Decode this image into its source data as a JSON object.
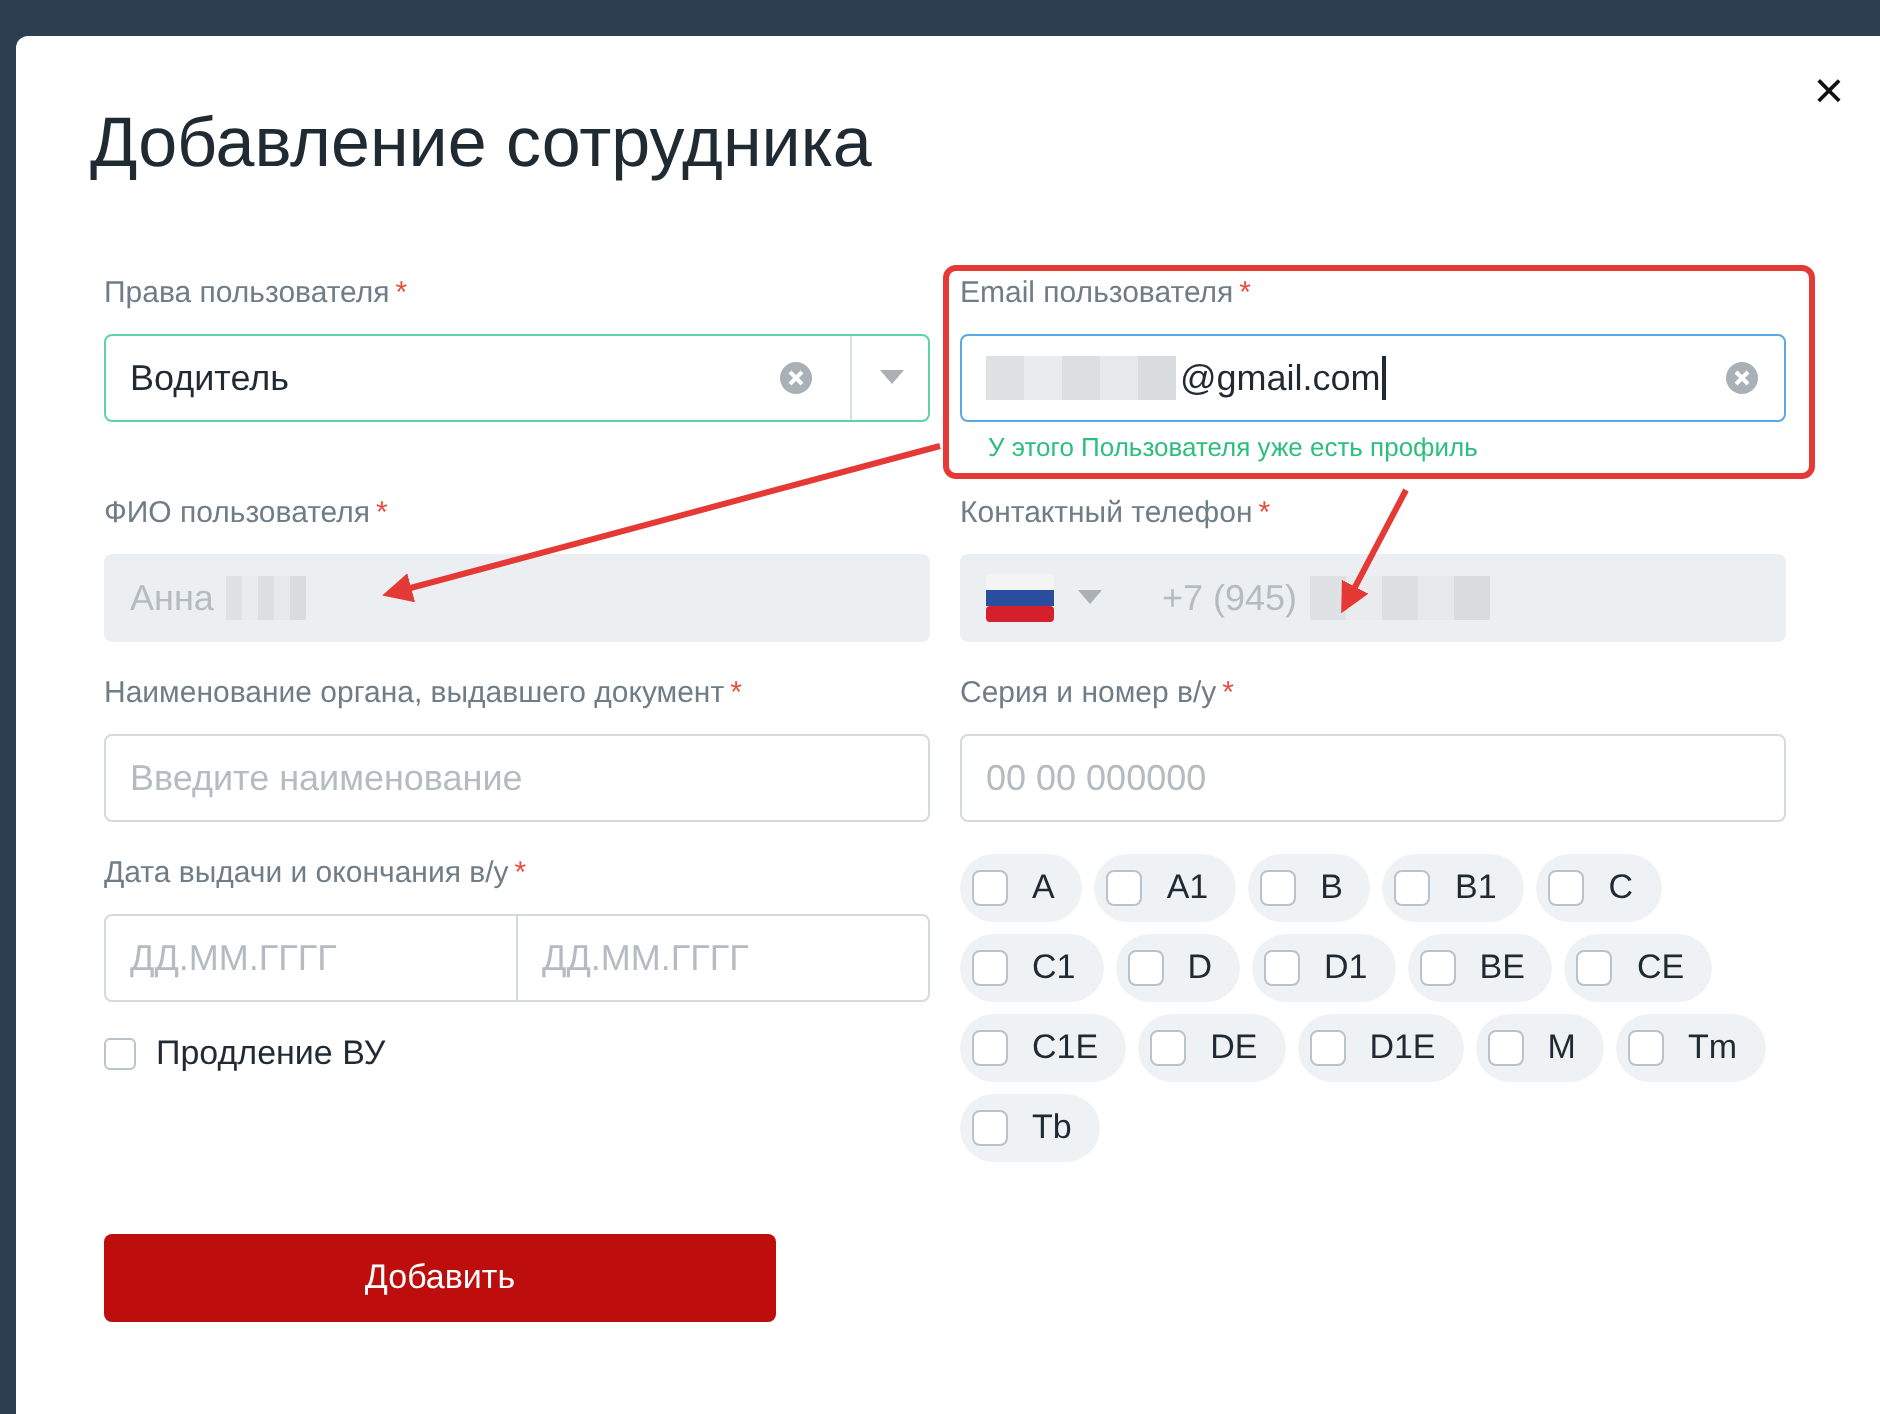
{
  "title": "Добавление сотрудника",
  "close": "×",
  "required_mark": "*",
  "role": {
    "label": "Права пользователя",
    "required": true,
    "value": "Водитель",
    "valid": true
  },
  "email": {
    "label": "Email пользователя",
    "required": true,
    "redacted": true,
    "value": "@gmail.com",
    "focused": true,
    "hint": "У этого Пользователя уже есть профиль"
  },
  "full_name": {
    "label": "ФИО пользователя",
    "required": true,
    "value": "Анна",
    "redacted": true,
    "disabled": true
  },
  "phone": {
    "label": "Контактный телефон",
    "required": true,
    "value": "+7 (945)",
    "redacted": true,
    "disabled": true
  },
  "issuer": {
    "label": "Наименование органа, выдавшего документ",
    "required": true,
    "placeholder": "Введите наименование"
  },
  "license_number": {
    "label": "Серия и номер в/у",
    "required": true,
    "placeholder": "00 00 000000"
  },
  "dates": {
    "label": "Дата выдачи и окончания в/у",
    "required": true,
    "from_placeholder": "ДД.ММ.ГГГГ",
    "to_placeholder": "ДД.ММ.ГГГГ"
  },
  "renewal": {
    "label": "Продление ВУ",
    "checked": false
  },
  "categories": [
    {
      "label": "A",
      "checked": false
    },
    {
      "label": "A1",
      "checked": false
    },
    {
      "label": "B",
      "checked": false
    },
    {
      "label": "B1",
      "checked": false
    },
    {
      "label": "C",
      "checked": false
    },
    {
      "label": "C1",
      "checked": false
    },
    {
      "label": "D",
      "checked": false
    },
    {
      "label": "D1",
      "checked": false
    },
    {
      "label": "BE",
      "checked": false
    },
    {
      "label": "CE",
      "checked": false
    },
    {
      "label": "C1E",
      "checked": false
    },
    {
      "label": "DE",
      "checked": false
    },
    {
      "label": "D1E",
      "checked": false
    },
    {
      "label": "M",
      "checked": false
    },
    {
      "label": "Tm",
      "checked": false
    },
    {
      "label": "Tb",
      "checked": false
    }
  ],
  "submit": "Добавить"
}
